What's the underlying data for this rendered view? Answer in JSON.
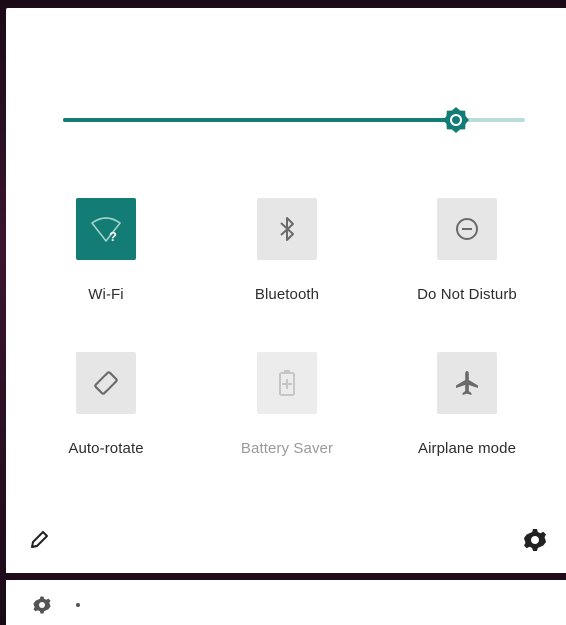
{
  "brightness": {
    "level": 0.85
  },
  "tiles": [
    {
      "label": "Wi-Fi",
      "icon": "wifi-unknown-icon",
      "state": "active"
    },
    {
      "label": "Bluetooth",
      "icon": "bluetooth-icon",
      "state": "off"
    },
    {
      "label": "Do Not Disturb",
      "icon": "do-not-disturb-icon",
      "state": "off"
    },
    {
      "label": "Auto-rotate",
      "icon": "auto-rotate-icon",
      "state": "off"
    },
    {
      "label": "Battery Saver",
      "icon": "battery-saver-icon",
      "state": "disabled"
    },
    {
      "label": "Airplane mode",
      "icon": "airplane-icon",
      "state": "off"
    }
  ],
  "colors": {
    "accent": "#137c74",
    "accent_light": "#b9dcda",
    "tile_off": "#e6e6e6"
  }
}
